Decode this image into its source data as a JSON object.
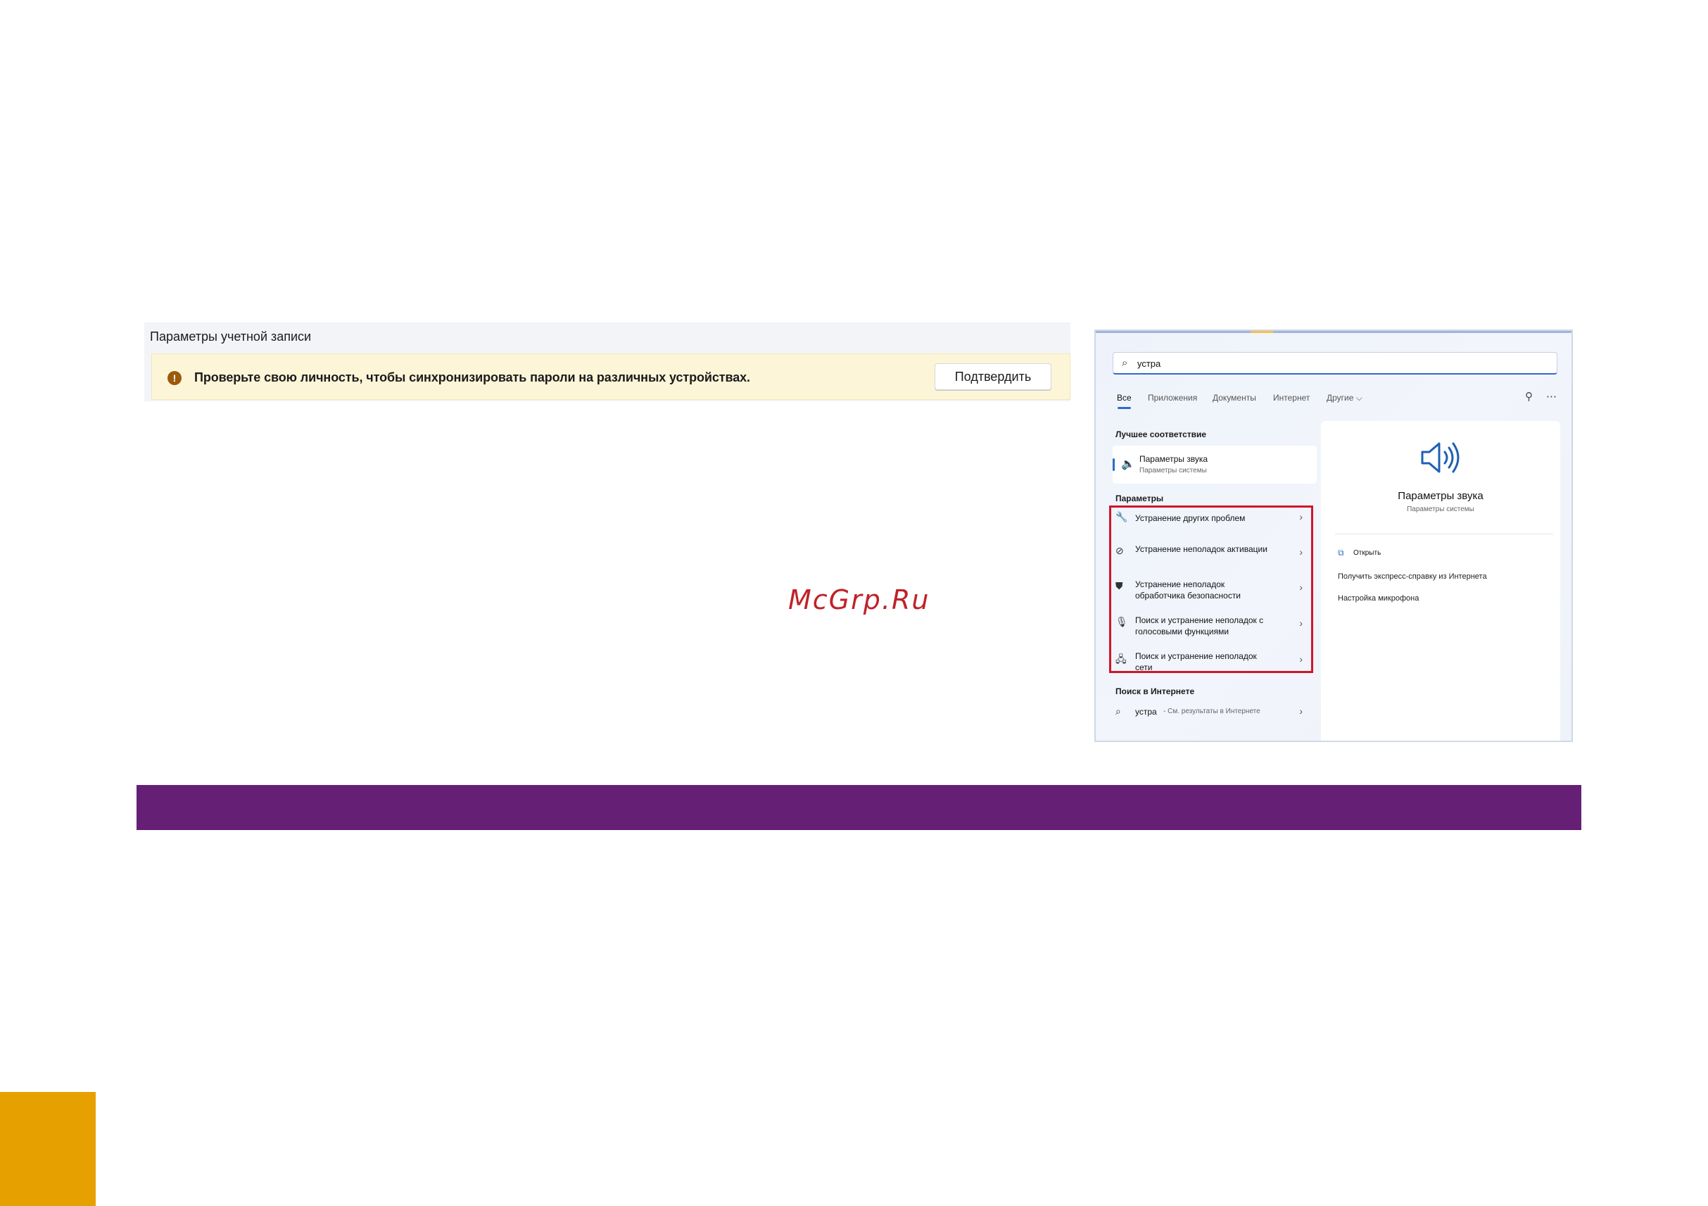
{
  "account": {
    "title": "Параметры учетной записи",
    "warning_icon": "!",
    "message": "Проверьте свою личность, чтобы синхронизировать пароли на различных устройствах.",
    "confirm_label": "Подтвердить"
  },
  "watermark": "McGrp.Ru",
  "search": {
    "query": "устра",
    "tabs": [
      "Все",
      "Приложения",
      "Документы",
      "Интернет",
      "Другие ⌵"
    ],
    "active_tab": "Все",
    "best_match_header": "Лучшее соответствие",
    "best_match": {
      "title": "Параметры звука",
      "subtitle": "Параметры системы",
      "icon": "speaker-icon"
    },
    "settings_header": "Параметры",
    "results": [
      {
        "text": "Устранение других проблем",
        "icon": "wrench-icon"
      },
      {
        "text": "Устранение неполадок активации",
        "icon": "check-circle-icon"
      },
      {
        "text": "Устранение неполадок обработчика безопасности",
        "icon": "shield-icon"
      },
      {
        "text": "Поиск и устранение неполадок с голосовыми функциями",
        "icon": "microphone-icon"
      },
      {
        "text": "Поиск и устранение неполадок сети",
        "icon": "network-icon"
      }
    ],
    "web_header": "Поиск в Интернете",
    "web_result": {
      "query": "устра",
      "suffix": "- См. результаты в Интернете"
    },
    "detail": {
      "title": "Параметры звука",
      "subtitle": "Параметры системы",
      "open_label": "Открыть",
      "help_label": "Получить экспресс-справку из Интернета",
      "mic_label": "Настройка микрофона"
    }
  },
  "colors": {
    "purple_bar": "#651f74",
    "gold_square": "#e6a100",
    "highlight_border": "#d0162a",
    "accent": "#2f6cc5"
  }
}
